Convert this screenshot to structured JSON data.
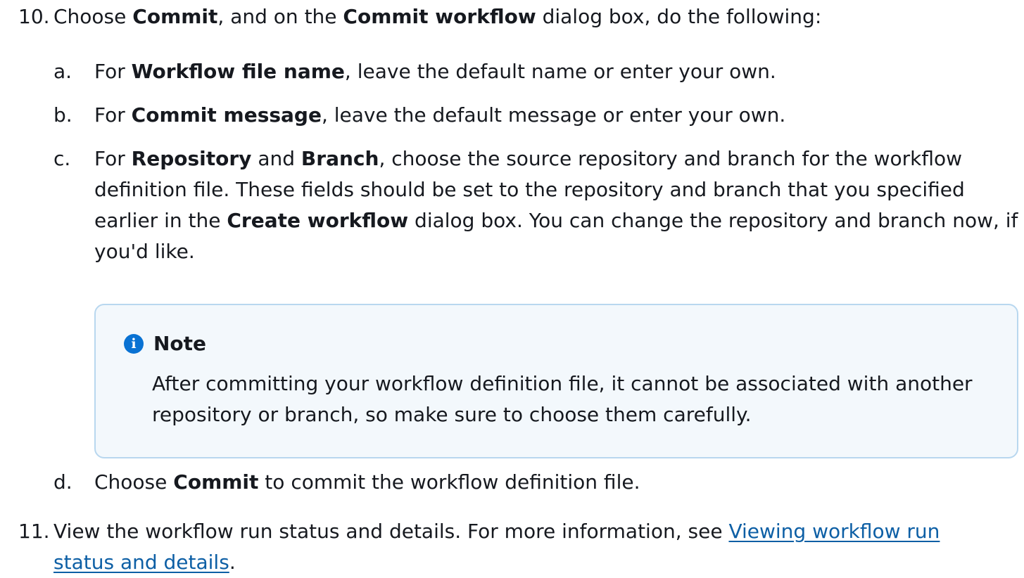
{
  "steps": {
    "s10": {
      "number": "10.",
      "t1": "Choose ",
      "b1": "Commit",
      "t2": ", and on the ",
      "b2": "Commit workflow",
      "t3": " dialog box, do the following:"
    },
    "s11": {
      "number": "11.",
      "t1": "View the workflow run status and details. For more information, see ",
      "link_line1": "Viewing workflow run",
      "link_line2": "status and details",
      "t2": "."
    }
  },
  "substeps": {
    "a": {
      "letter": "a.",
      "t1": "For ",
      "b1": "Workflow file name",
      "t2": ", leave the default name or enter your own."
    },
    "b": {
      "letter": "b.",
      "t1": "For ",
      "b1": "Commit message",
      "t2": ", leave the default message or enter your own."
    },
    "c": {
      "letter": "c.",
      "t1": "For ",
      "b1": "Repository",
      "t2": " and ",
      "b2": "Branch",
      "t3": ", choose the source repository and branch for the workflow definition file. These fields should be set to the repository and branch that you specified earlier in the ",
      "b3": "Create workflow",
      "t4": " dialog box. You can change the repository and branch now, if you'd like."
    },
    "d": {
      "letter": "d.",
      "t1": "Choose ",
      "b1": "Commit",
      "t2": " to commit the workflow definition file."
    }
  },
  "note": {
    "icon": "info-icon",
    "title": "Note",
    "body": "After committing your workflow definition file, it cannot be associated with another repository or branch, so make sure to choose them carefully."
  }
}
